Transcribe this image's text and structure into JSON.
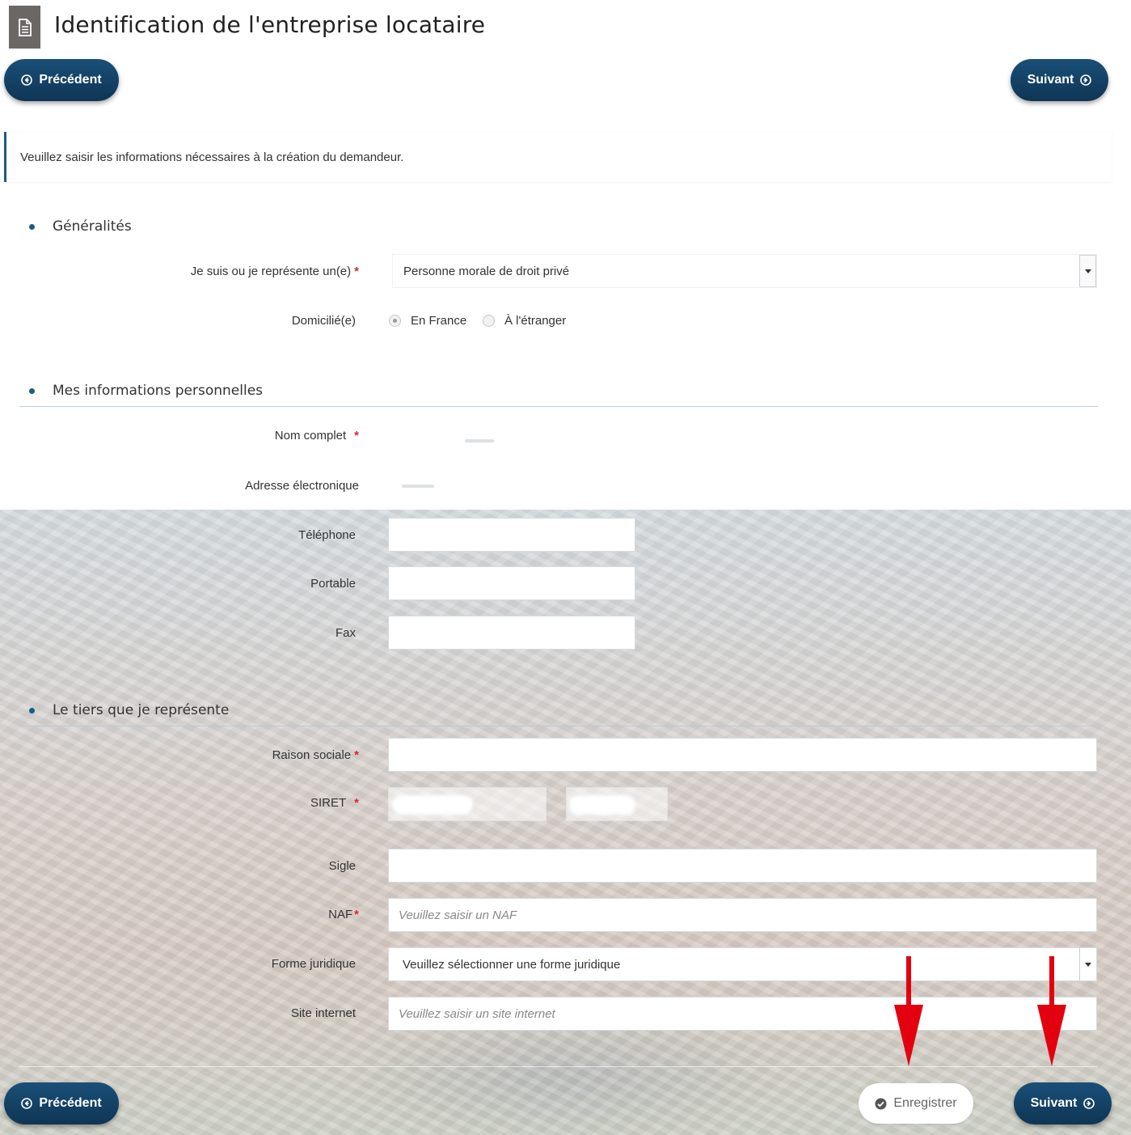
{
  "header": {
    "icon": "document-icon",
    "title": "Identification de l'entreprise locataire"
  },
  "nav": {
    "previous_label": "Précédent",
    "next_label": "Suivant",
    "save_label": "Enregistrer"
  },
  "info": {
    "message": "Veuillez saisir les informations nécessaires à la création du demandeur."
  },
  "sections": {
    "general": {
      "title": "Généralités",
      "represent_label": "Je suis ou je représente un(e)",
      "represent_value": "Personne morale de droit privé",
      "domicile_label": "Domicilié(e)",
      "domicile_options": [
        "En France",
        "À l'étranger"
      ],
      "domicile_selected": "En France"
    },
    "personal": {
      "title": "Mes informations personnelles",
      "fullname_label": "Nom complet",
      "email_label": "Adresse électronique",
      "phone_label": "Téléphone",
      "mobile_label": "Portable",
      "fax_label": "Fax"
    },
    "company": {
      "title": "Le tiers que je représente",
      "raison_label": "Raison sociale",
      "siret_label": "SIRET",
      "sigle_label": "Sigle",
      "naf_label": "NAF",
      "naf_placeholder": "Veuillez saisir un NAF",
      "forme_label": "Forme juridique",
      "forme_value": "Veuillez sélectionner une forme juridique",
      "site_label": "Site internet",
      "site_placeholder": "Veuillez saisir un site internet"
    }
  },
  "colors": {
    "primary": "#0f3554",
    "required": "#d9262a",
    "annotation_arrow": "#e3000f"
  }
}
